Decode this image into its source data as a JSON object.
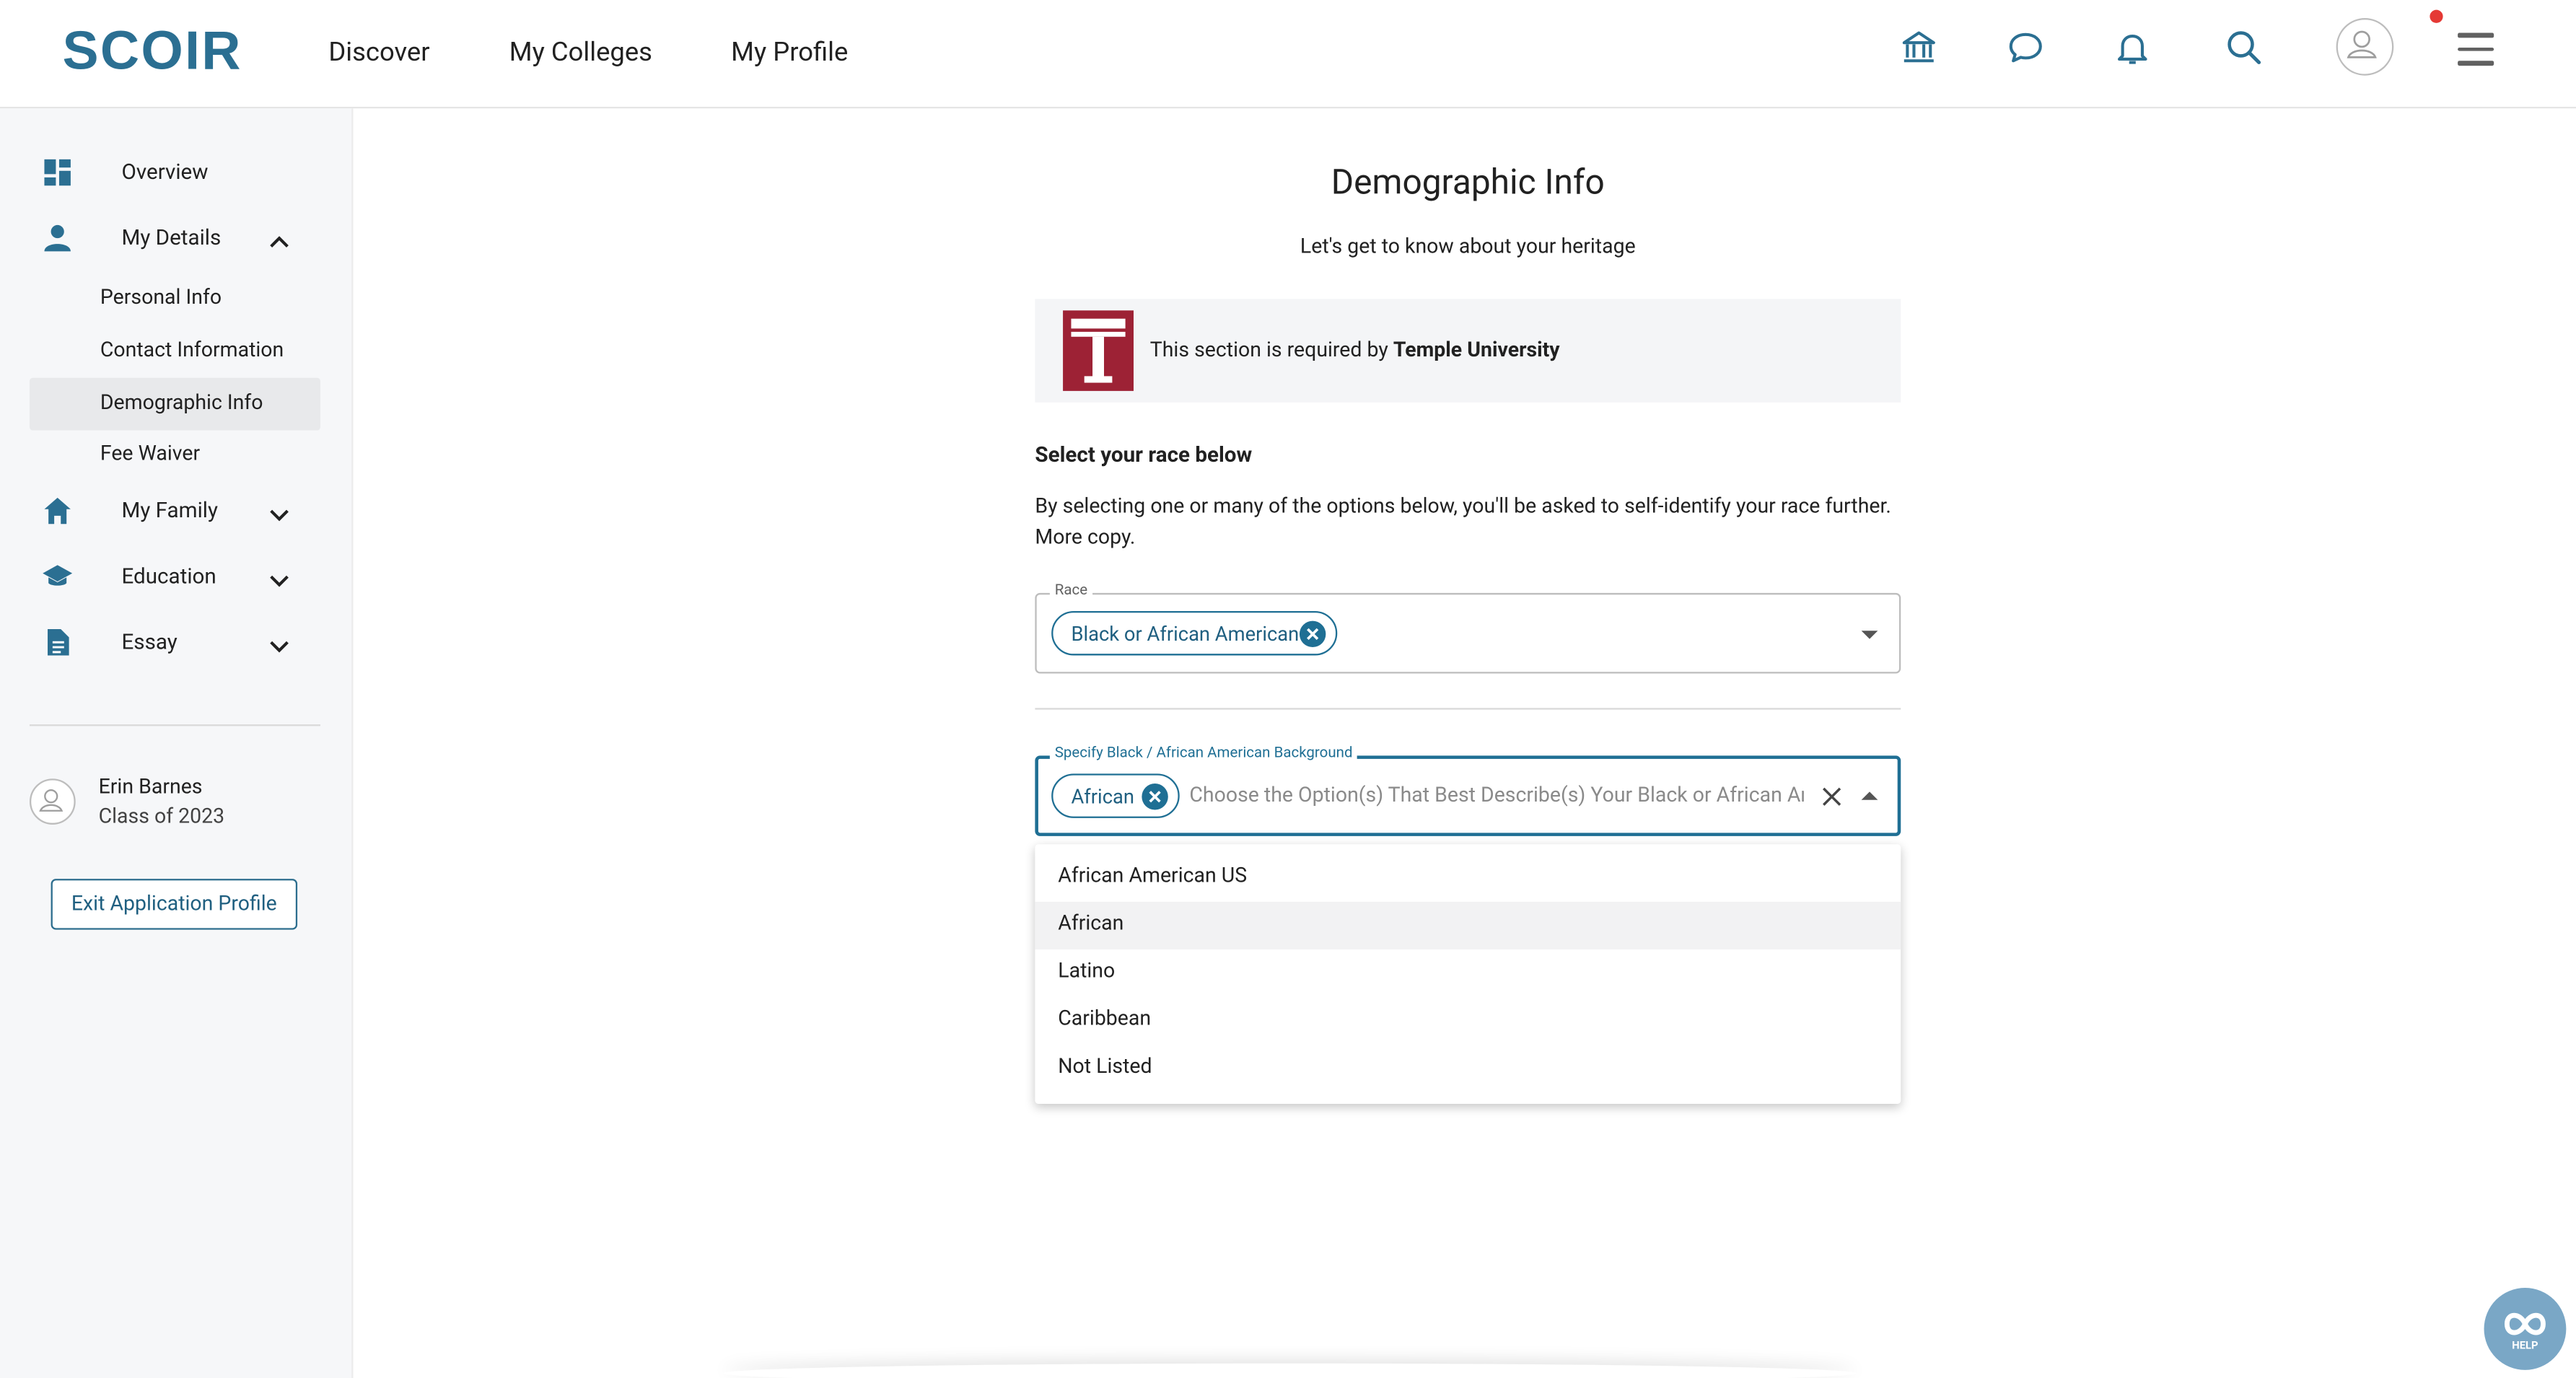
{
  "header": {
    "logo_text": "SCOIR",
    "nav": [
      "Discover",
      "My Colleges",
      "My Profile"
    ],
    "icons": [
      "institution-icon",
      "chat-icon",
      "bell-icon",
      "search-icon",
      "avatar-icon",
      "menu-icon"
    ],
    "notification_dot_color": "#e53935"
  },
  "sidebar": {
    "items": [
      {
        "label": "Overview",
        "icon": "dashboard-icon"
      },
      {
        "label": "My Details",
        "icon": "person-icon",
        "expanded": true
      },
      {
        "label": "My Family",
        "icon": "home-icon",
        "expanded": false
      },
      {
        "label": "Education",
        "icon": "school-icon",
        "expanded": false
      },
      {
        "label": "Essay",
        "icon": "document-icon",
        "expanded": false
      }
    ],
    "subitems": [
      "Personal Info",
      "Contact Information",
      "Demographic Info",
      "Fee Waiver"
    ],
    "active_subitem": "Demographic Info",
    "user": {
      "name": "Erin Barnes",
      "class": "Class of 2023"
    },
    "exit_button": "Exit Application Profile"
  },
  "main": {
    "title": "Demographic Info",
    "subtitle": "Let's get to know about your heritage",
    "requirement": {
      "prefix": "This section is required by ",
      "university": "Temple University"
    },
    "section_heading": "Select your race below",
    "section_description": "By selecting one or many of the options below, you'll be asked to self-identify your race further. More copy.",
    "race_field": {
      "label": "Race",
      "selected": [
        "Black or African American"
      ]
    },
    "background_field": {
      "label": "Specify Black / African American Background",
      "selected": [
        "African"
      ],
      "placeholder": "Choose the Option(s) That Best Describe(s) Your Black or African American Background"
    },
    "dropdown_options": [
      "African American US",
      "African",
      "Latino",
      "Caribbean",
      "Not Listed"
    ],
    "highlighted_option": "African"
  },
  "help_button": {
    "label": "HELP"
  },
  "colors": {
    "brand": "#1f6f94",
    "temple": "#9d2235",
    "sidebar_bg": "#f6f7f9"
  }
}
